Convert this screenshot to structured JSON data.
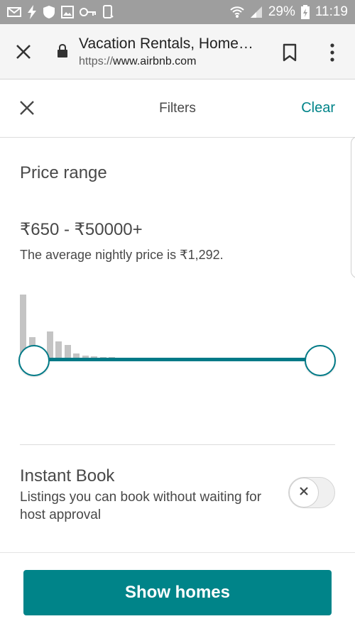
{
  "status_bar": {
    "battery": "29%",
    "time": "11:19",
    "icons": [
      "mail-icon",
      "flash-icon",
      "shield-icon",
      "image-icon",
      "key-icon",
      "phone-icon",
      "wifi-icon",
      "signal-icon",
      "battery-icon"
    ]
  },
  "browser": {
    "title": "Vacation Rentals, Home…",
    "url_scheme": "https://",
    "url_host": "www.airbnb.com",
    "icons": [
      "close-icon",
      "lock-icon",
      "bookmark-icon",
      "more-vert-icon"
    ]
  },
  "filters": {
    "title": "Filters",
    "clear_label": "Clear"
  },
  "price": {
    "section_title": "Price range",
    "range_text": "₹650 - ₹50000+",
    "average_text": "The average nightly price is ₹1,292.",
    "slider_min_fraction": 0.0,
    "slider_max_fraction": 1.0,
    "histogram_levels": [
      1.0,
      0.33,
      0.0,
      0.42,
      0.27,
      0.21,
      0.08,
      0.05,
      0.03,
      0.02,
      0.01
    ]
  },
  "instant_book": {
    "title": "Instant Book",
    "description": "Listings you can book without waiting for host approval",
    "enabled": false
  },
  "actions": {
    "show_homes_label": "Show homes"
  },
  "colors": {
    "accent": "#008489",
    "status_bar": "#9e9e9e",
    "histogram": "#c4c4c4"
  }
}
